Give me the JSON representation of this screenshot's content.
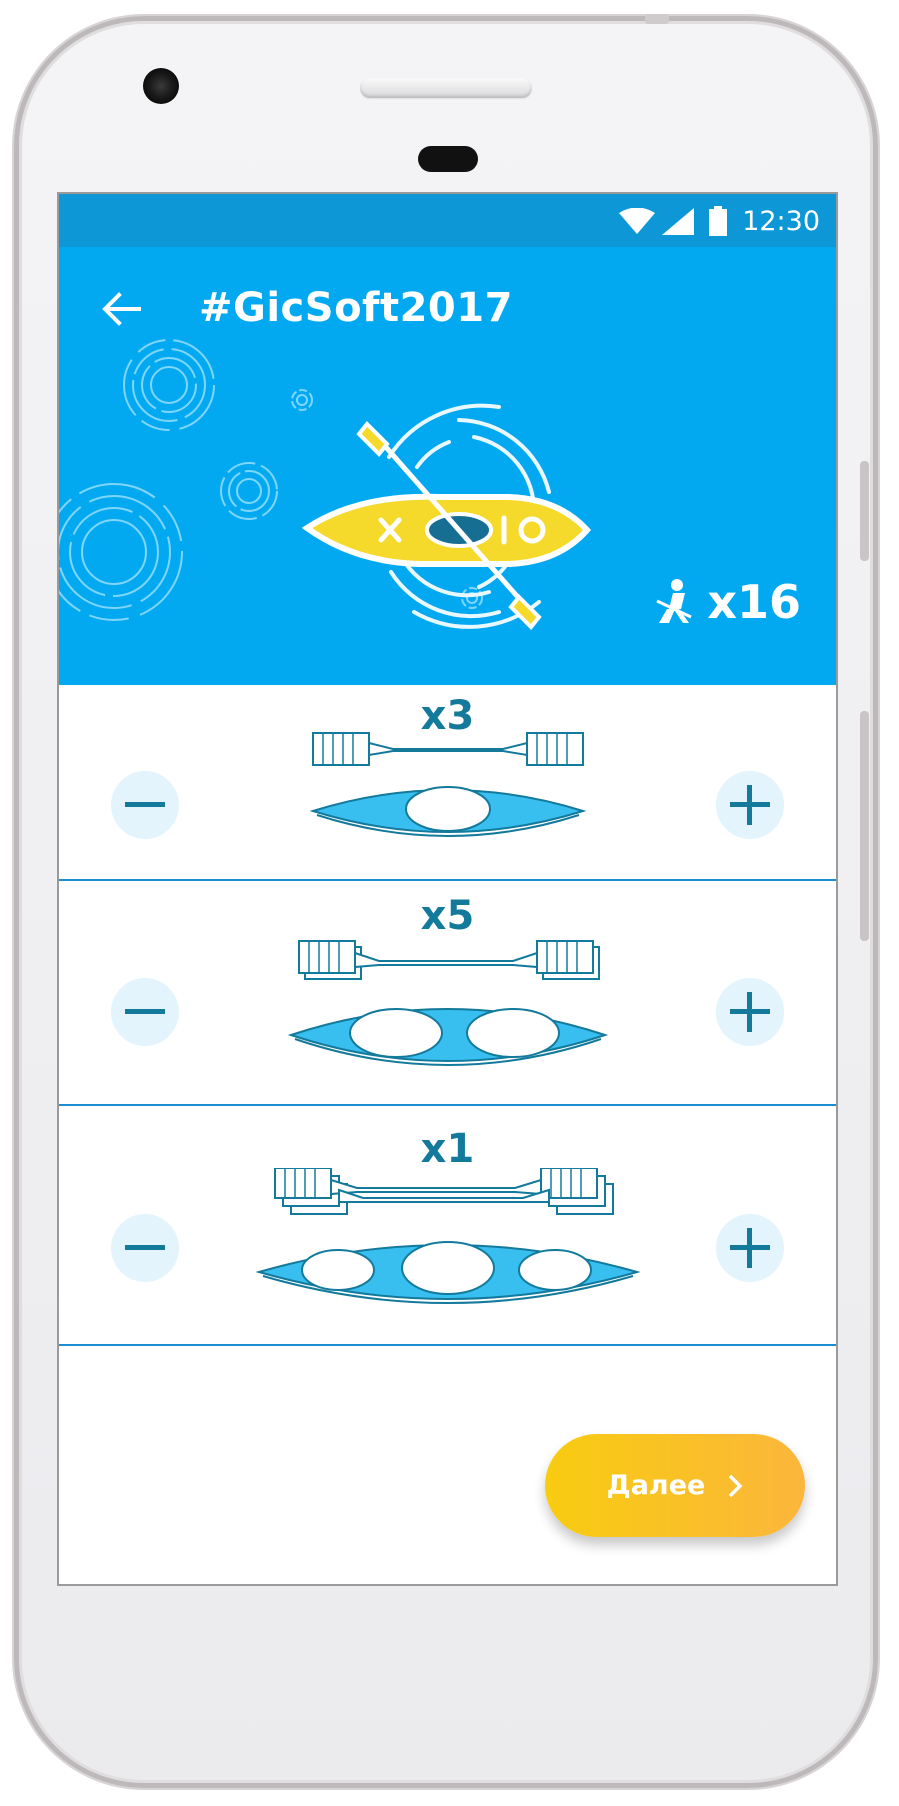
{
  "status_bar": {
    "time": "12:30"
  },
  "header": {
    "title": "#GicSoft2017",
    "people_count": "x16"
  },
  "boats": [
    {
      "count": "x3",
      "seats": 1
    },
    {
      "count": "x5",
      "seats": 2
    },
    {
      "count": "x1",
      "seats": 3
    }
  ],
  "next_button": {
    "label": "Далее"
  },
  "colors": {
    "status_bar": "#0d97d6",
    "header": "#03a9f0",
    "accent_text": "#137a9c",
    "boat_fill": "#38bff0",
    "button_gradient_start": "#f8cc10",
    "button_gradient_end": "#fbb63c"
  }
}
